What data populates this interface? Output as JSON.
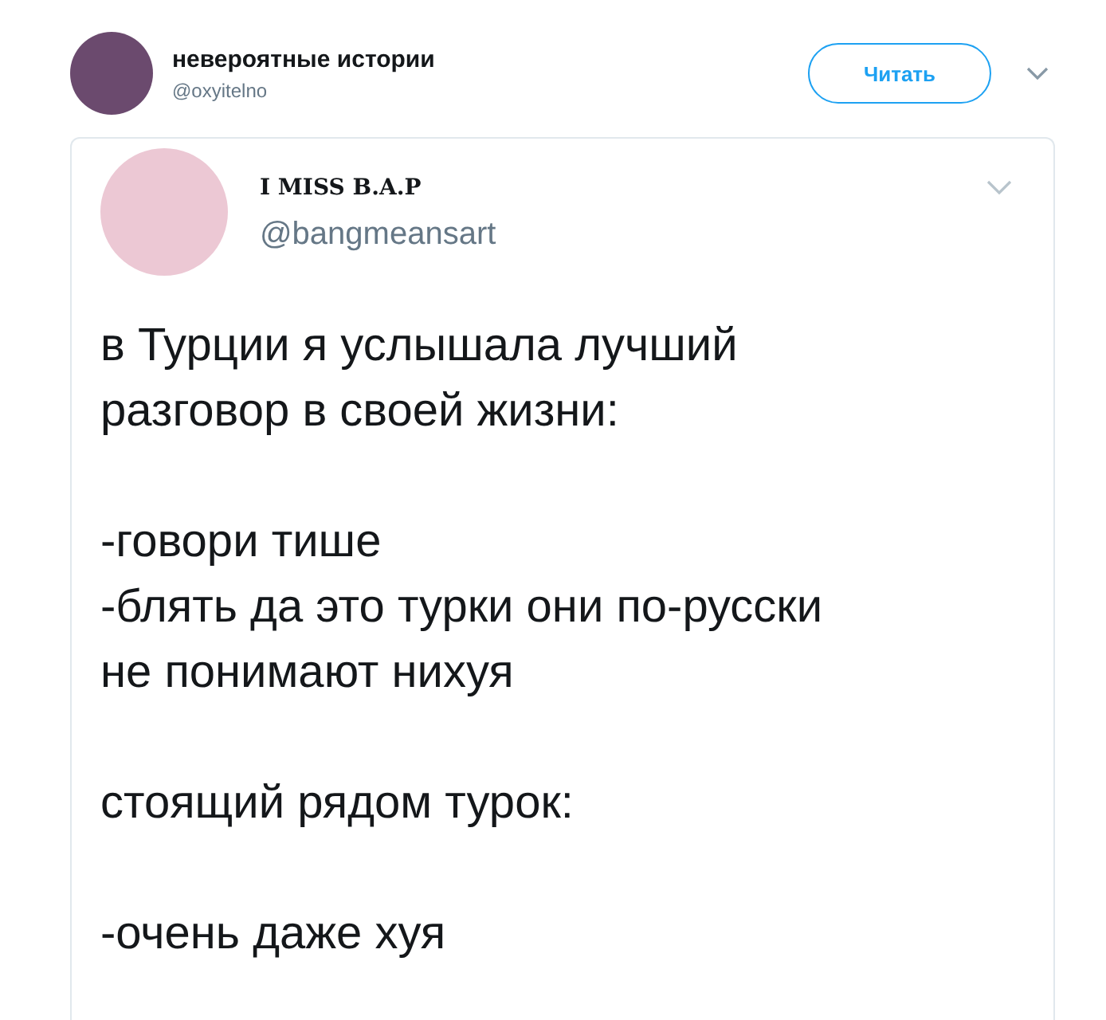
{
  "tweet": {
    "author": {
      "name": "невероятные истории",
      "handle": "@oxyitelno"
    },
    "follow_button": "Читать",
    "quoted": {
      "author": {
        "name": "I MISS B.A.P",
        "handle": "@bangmeansart"
      },
      "paragraphs": [
        "в Турции я услышала лучший\nразговор в своей жизни:",
        "-говори тише\n-блять да это турки они по-русски\nне понимают нихуя",
        "стоящий рядом турок:",
        "-очень даже хуя"
      ]
    }
  }
}
